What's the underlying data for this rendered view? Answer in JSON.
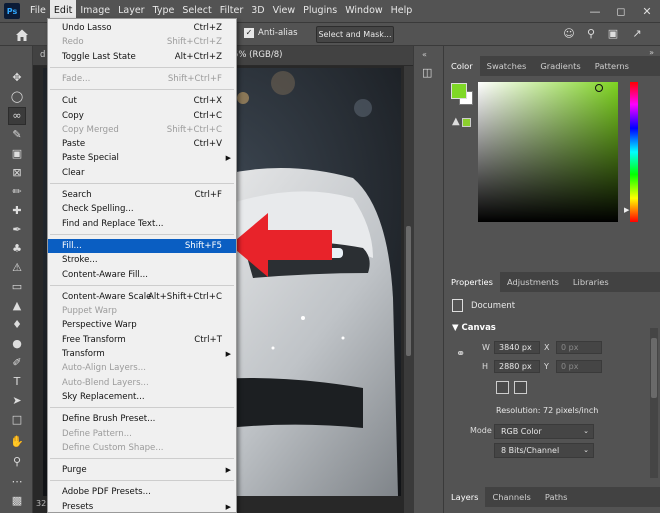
{
  "app": {
    "logo": "Ps"
  },
  "menubar": {
    "items": [
      "File",
      "Edit",
      "Image",
      "Layer",
      "Type",
      "Select",
      "Filter",
      "3D",
      "View",
      "Plugins",
      "Window",
      "Help"
    ],
    "active": "Edit",
    "window_controls": [
      "minimize-icon",
      "maximize-icon",
      "close-icon"
    ]
  },
  "optionsbar": {
    "anti_alias_label": "Anti-alias",
    "anti_alias_checked": true,
    "select_mask_label": "Select and Mask..."
  },
  "document": {
    "tab_title": "5% (RGB/8)",
    "tab_prefix": "d",
    "zoom_status": "32"
  },
  "edit_menu": {
    "groups": [
      [
        {
          "label": "Undo Lasso",
          "shortcut": "Ctrl+Z",
          "enabled": true
        },
        {
          "label": "Redo",
          "shortcut": "Shift+Ctrl+Z",
          "enabled": false
        },
        {
          "label": "Toggle Last State",
          "shortcut": "Alt+Ctrl+Z",
          "enabled": true
        }
      ],
      [
        {
          "label": "Fade...",
          "shortcut": "Shift+Ctrl+F",
          "enabled": false
        }
      ],
      [
        {
          "label": "Cut",
          "shortcut": "Ctrl+X",
          "enabled": true
        },
        {
          "label": "Copy",
          "shortcut": "Ctrl+C",
          "enabled": true
        },
        {
          "label": "Copy Merged",
          "shortcut": "Shift+Ctrl+C",
          "enabled": false
        },
        {
          "label": "Paste",
          "shortcut": "Ctrl+V",
          "enabled": true
        },
        {
          "label": "Paste Special",
          "shortcut": "",
          "enabled": true,
          "submenu": true
        },
        {
          "label": "Clear",
          "shortcut": "",
          "enabled": true
        }
      ],
      [
        {
          "label": "Search",
          "shortcut": "Ctrl+F",
          "enabled": true
        },
        {
          "label": "Check Spelling...",
          "shortcut": "",
          "enabled": true
        },
        {
          "label": "Find and Replace Text...",
          "shortcut": "",
          "enabled": true
        }
      ],
      [
        {
          "label": "Fill...",
          "shortcut": "Shift+F5",
          "enabled": true,
          "highlighted": true
        },
        {
          "label": "Stroke...",
          "shortcut": "",
          "enabled": true
        },
        {
          "label": "Content-Aware Fill...",
          "shortcut": "",
          "enabled": true
        }
      ],
      [
        {
          "label": "Content-Aware Scale",
          "shortcut": "Alt+Shift+Ctrl+C",
          "enabled": true
        },
        {
          "label": "Puppet Warp",
          "shortcut": "",
          "enabled": false
        },
        {
          "label": "Perspective Warp",
          "shortcut": "",
          "enabled": true
        },
        {
          "label": "Free Transform",
          "shortcut": "Ctrl+T",
          "enabled": true
        },
        {
          "label": "Transform",
          "shortcut": "",
          "enabled": true,
          "submenu": true
        },
        {
          "label": "Auto-Align Layers...",
          "shortcut": "",
          "enabled": false
        },
        {
          "label": "Auto-Blend Layers...",
          "shortcut": "",
          "enabled": false
        },
        {
          "label": "Sky Replacement...",
          "shortcut": "",
          "enabled": true
        }
      ],
      [
        {
          "label": "Define Brush Preset...",
          "shortcut": "",
          "enabled": true
        },
        {
          "label": "Define Pattern...",
          "shortcut": "",
          "enabled": false
        },
        {
          "label": "Define Custom Shape...",
          "shortcut": "",
          "enabled": false
        }
      ],
      [
        {
          "label": "Purge",
          "shortcut": "",
          "enabled": true,
          "submenu": true
        }
      ],
      [
        {
          "label": "Adobe PDF Presets...",
          "shortcut": "",
          "enabled": true
        },
        {
          "label": "Presets",
          "shortcut": "",
          "enabled": true,
          "submenu": true
        }
      ]
    ]
  },
  "color_panel": {
    "tabs": [
      "Color",
      "Swatches",
      "Gradients",
      "Patterns"
    ],
    "active_tab": "Color",
    "foreground": "#7fd826",
    "background": "#ffffff"
  },
  "properties_panel": {
    "tabs": [
      "Properties",
      "Adjustments",
      "Libraries"
    ],
    "active_tab": "Properties",
    "doc_label": "Document",
    "canvas_heading": "Canvas",
    "width_label": "W",
    "width_value": "3840 px",
    "height_label": "H",
    "height_value": "2880 px",
    "x_label": "X",
    "x_placeholder": "0 px",
    "y_label": "Y",
    "y_placeholder": "0 px",
    "resolution": "Resolution: 72 pixels/inch",
    "mode_label": "Mode",
    "mode_value": "RGB Color",
    "depth_value": "8 Bits/Channel"
  },
  "layers_panel": {
    "tabs": [
      "Layers",
      "Channels",
      "Paths"
    ],
    "active_tab": "Layers"
  },
  "colors": {
    "arrow": "#e8232a",
    "highlight": "#0a5ec2"
  }
}
